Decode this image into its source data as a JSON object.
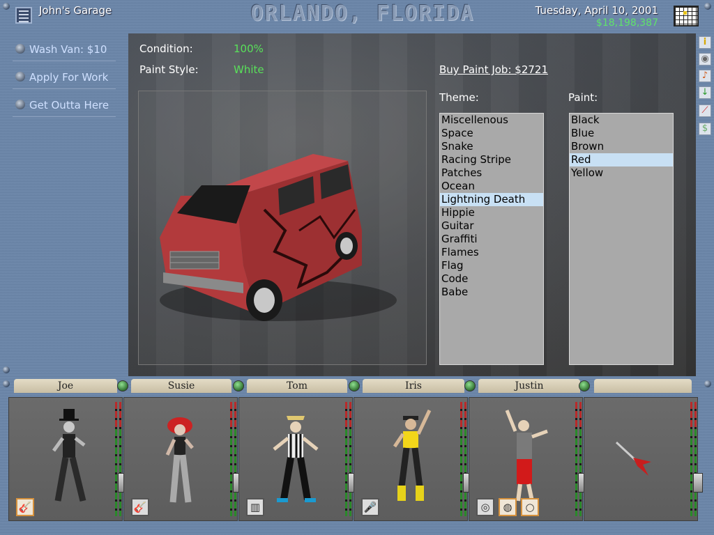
{
  "header": {
    "garage_name": "John's Garage",
    "city": "ORLANDO, FLORIDA",
    "date": "Tuesday, April 10, 2001",
    "money": "$18,198,387"
  },
  "left_menu": [
    {
      "label": "Wash Van: $10"
    },
    {
      "label": "Apply For Work"
    },
    {
      "label": "Get Outta Here"
    }
  ],
  "van": {
    "condition_label": "Condition:",
    "condition_value": "100%",
    "paint_style_label": "Paint Style:",
    "paint_style_value": "White",
    "buy_paint": "Buy Paint Job: $2721",
    "colors": {
      "body": "#b23a3c",
      "accent_green": "#59e15a"
    }
  },
  "theme": {
    "title": "Theme:",
    "options": [
      "Miscellenous",
      "Space",
      "Snake",
      "Racing Stripe",
      "Patches",
      "Ocean",
      "Lightning Death",
      "Hippie",
      "Guitar",
      "Graffiti",
      "Flames",
      "Flag",
      "Code",
      "Babe"
    ],
    "selected": "Lightning Death"
  },
  "paint": {
    "title": "Paint:",
    "options": [
      "Black",
      "Blue",
      "Brown",
      "Red",
      "Yellow"
    ],
    "selected": "Red"
  },
  "side_icons": [
    "info-icon",
    "cd-icon",
    "music-note-icon",
    "thermometer-icon",
    "chart-icon",
    "money-icon"
  ],
  "band": [
    {
      "name": "Joe",
      "instruments": [
        "guitar-icon"
      ]
    },
    {
      "name": "Susie",
      "instruments": [
        "bass-guitar-icon"
      ]
    },
    {
      "name": "Tom",
      "instruments": [
        "keyboard-icon"
      ]
    },
    {
      "name": "Iris",
      "instruments": [
        "microphone-icon"
      ]
    },
    {
      "name": "Justin",
      "instruments": [
        "snare-drum-icon",
        "tambourine-icon",
        "cymbal-icon"
      ]
    },
    {
      "name": "",
      "instruments": [
        "flying-v-guitar-icon"
      ]
    }
  ]
}
